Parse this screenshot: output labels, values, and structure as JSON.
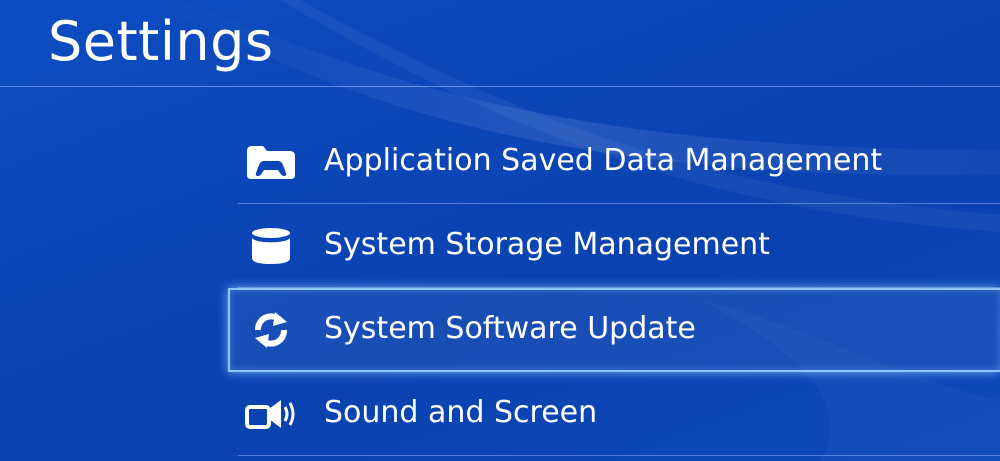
{
  "page": {
    "title": "Settings"
  },
  "menu": {
    "items": [
      {
        "label": "Application Saved Data Management",
        "icon": "folder-controller-icon",
        "selected": false
      },
      {
        "label": "System Storage Management",
        "icon": "storage-cylinder-icon",
        "selected": false
      },
      {
        "label": "System Software Update",
        "icon": "update-arrows-icon",
        "selected": true
      },
      {
        "label": "Sound and Screen",
        "icon": "speaker-screen-icon",
        "selected": false
      }
    ]
  },
  "colors": {
    "background": "#0b46b8",
    "text": "#ffffff",
    "focus_outline": "#8fc6ff",
    "divider": "#aac8ff"
  }
}
